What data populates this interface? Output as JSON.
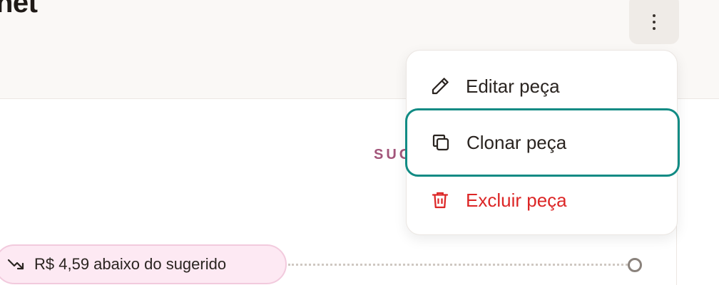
{
  "header": {
    "title_fragment": "net"
  },
  "column_heading": "SUG",
  "price_badge": {
    "text": "R$ 4,59 abaixo do sugerido",
    "icon": "trending-down-icon"
  },
  "menu": {
    "items": [
      {
        "label": "Editar peça",
        "icon": "pencil-icon"
      },
      {
        "label": "Clonar peça",
        "icon": "copy-icon"
      },
      {
        "label": "Excluir peça",
        "icon": "trash-icon",
        "color": "#dc2626"
      }
    ],
    "focus_color": "#118b84"
  },
  "colors": {
    "accent_pink": "#a2557a",
    "badge_bg": "#fde9f3",
    "danger": "#dc2626"
  }
}
